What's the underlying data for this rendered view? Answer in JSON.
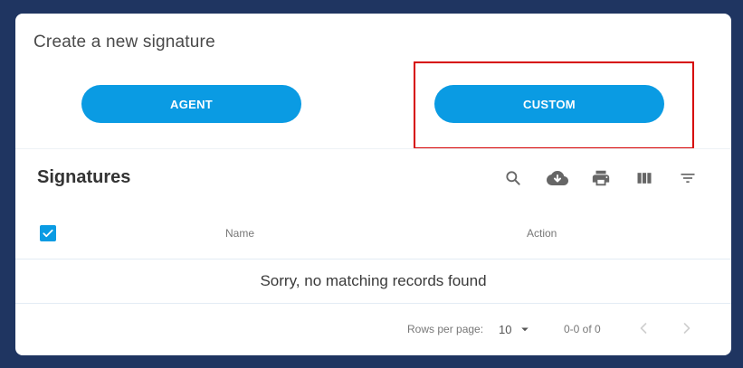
{
  "create": {
    "title": "Create a new signature",
    "buttons": {
      "agent": "AGENT",
      "custom": "CUSTOM"
    }
  },
  "table": {
    "title": "Signatures",
    "toolbar": [
      "search-icon",
      "download-icon",
      "print-icon",
      "view-columns-icon",
      "filter-icon"
    ],
    "columns": {
      "name": "Name",
      "action": "Action"
    },
    "empty_message": "Sorry, no matching records found",
    "select_all_checked": true
  },
  "pagination": {
    "rows_per_page_label": "Rows per page:",
    "rows_per_page_value": "10",
    "range": "0-0 of 0"
  },
  "colors": {
    "background": "#1f3561",
    "accent": "#0a9be3",
    "highlight": "#d60000"
  }
}
